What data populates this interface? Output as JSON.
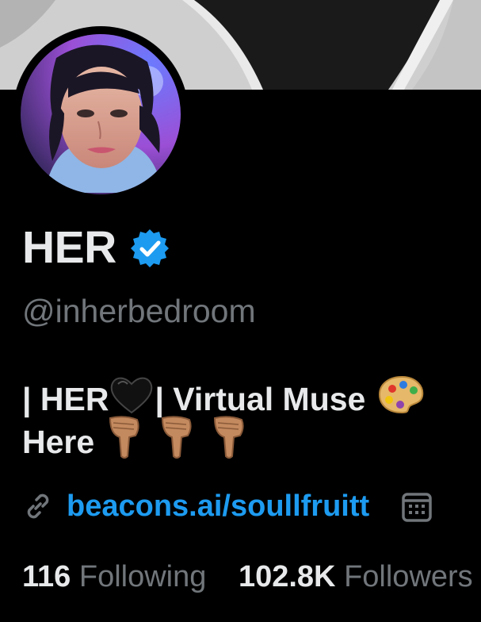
{
  "profile": {
    "display_name": "HER",
    "handle": "@inherbedroom",
    "verified": true,
    "bio": {
      "line1_part1": "| HER",
      "line1_part2": " | Virtual Muse",
      "line2_text": "Here",
      "emojis": [
        "black-heart",
        "artist-palette",
        "pointing-down-hand",
        "pointing-down-hand",
        "pointing-down-hand"
      ]
    },
    "link": "beacons.ai/soullfruitt"
  },
  "stats": {
    "following_count": "116",
    "following_label": "Following",
    "followers_count": "102.8K",
    "followers_label": "Followers"
  },
  "colors": {
    "background": "#000000",
    "text_primary": "#e7e9ea",
    "text_secondary": "#71767b",
    "link": "#1d9bf0",
    "verified_badge": "#1d9bf0"
  }
}
